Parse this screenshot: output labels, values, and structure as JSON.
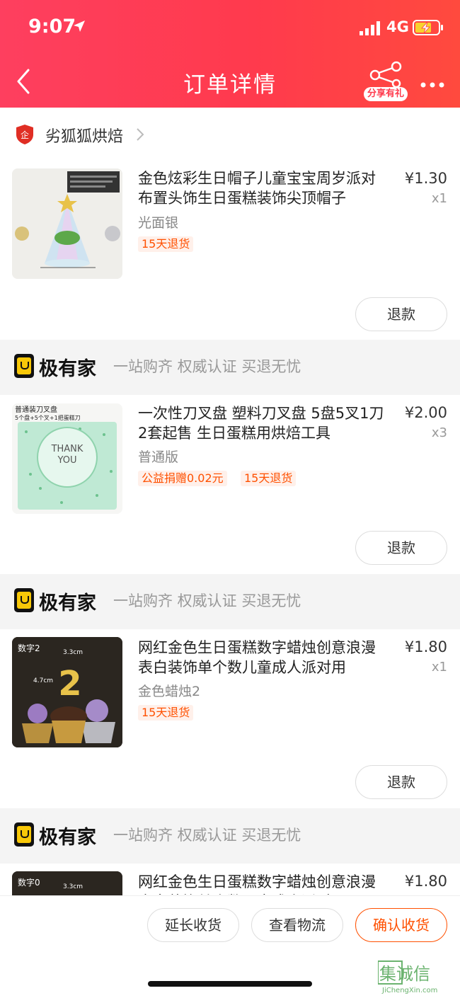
{
  "status_bar": {
    "time": "9:07",
    "network": "4G"
  },
  "nav": {
    "title": "订单详情",
    "share_label": "分享有礼"
  },
  "store": {
    "name": "劣狐狐烘焙"
  },
  "banner": {
    "brand": "极有家",
    "slogan": "一站购齐 权威认证 买退无忧"
  },
  "items": [
    {
      "title": "金色炫彩生日帽子儿童宝宝周岁派对布置头饰生日蛋糕装饰尖顶帽子",
      "variant": "光面银",
      "tags": [
        "15天退货"
      ],
      "price": "¥1.30",
      "qty": "x1",
      "refund_label": "退款"
    },
    {
      "title": "一次性刀叉盘 塑料刀叉盘 5盘5叉1刀 2套起售 生日蛋糕用烘焙工具",
      "variant": "普通版",
      "tags": [
        "公益捐赠0.02元",
        "15天退货"
      ],
      "price": "¥2.00",
      "qty": "x3",
      "refund_label": "退款",
      "img_text": {
        "line1": "普通装刀叉盘",
        "line2": "5个盘+5个叉+1把蛋糕刀",
        "plate1": "THANK",
        "plate2": "YOU"
      }
    },
    {
      "title": "网红金色生日蛋糕数字蜡烛创意浪漫表白装饰单个数儿童成人派对用",
      "variant": "金色蜡烛2",
      "tags": [
        "15天退货"
      ],
      "price": "¥1.80",
      "qty": "x1",
      "refund_label": "退款",
      "img_text": {
        "label": "数字2",
        "digit": "2",
        "dim1": "3.3cm",
        "dim2": "4.7cm"
      }
    },
    {
      "title": "网红金色生日蛋糕数字蜡烛创意浪漫表白装饰单个数儿童成人派对用",
      "price": "¥1.80",
      "img_text": {
        "label": "数字0",
        "dim1": "3.3cm"
      }
    }
  ],
  "actions": {
    "extend": "延长收货",
    "logistics": "查看物流",
    "confirm": "确认收货"
  },
  "watermark": {
    "name": "集诚信",
    "url": "JiChengXin.com"
  },
  "colors": {
    "brand_red": "#ff3a4d",
    "accent_orange": "#ff5000",
    "tag_bg": "#fff0ea"
  }
}
